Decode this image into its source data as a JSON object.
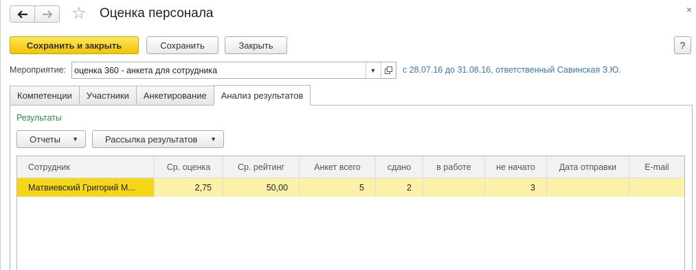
{
  "window": {
    "title": "Оценка персонала",
    "close_glyph": "×"
  },
  "toolbar": {
    "save_close_label": "Сохранить и закрыть",
    "save_label": "Сохранить",
    "close_label": "Закрыть",
    "help_label": "?"
  },
  "event": {
    "label": "Мероприятие:",
    "value": "оценка 360 - анкета для сотрудника",
    "info": "с 28.07.16 до 31.08.16, ответственный Савинская З.Ю."
  },
  "tabs": [
    {
      "label": "Компетенции"
    },
    {
      "label": "Участники"
    },
    {
      "label": "Анкетирование"
    },
    {
      "label": "Анализ результатов"
    }
  ],
  "results": {
    "label": "Результаты",
    "reports_label": "Отчеты",
    "mailing_label": "Рассылка результатов"
  },
  "table": {
    "columns": [
      "Сотрудник",
      "Ср. оценка",
      "Ср. рейтинг",
      "Анкет всего",
      "сдано",
      "в работе",
      "не начато",
      "Дата отправки",
      "E-mail"
    ],
    "rows": [
      {
        "employee": "Матвиевский Григорий М...",
        "avg_score": "2,75",
        "avg_rating": "50,00",
        "total": "5",
        "submitted": "2",
        "in_progress": "",
        "not_started": "3",
        "sent_date": "",
        "email": ""
      }
    ]
  },
  "colors": {
    "primary_button": "#f4c400",
    "link": "#3a77b1",
    "group_label": "#2e8b3a",
    "row_highlight": "#fbf2a8",
    "cell_selected": "#f6d619"
  }
}
